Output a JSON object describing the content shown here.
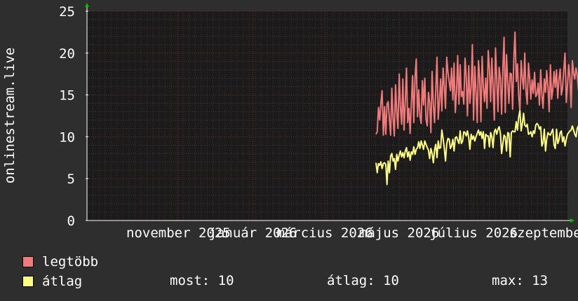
{
  "chart_data": {
    "type": "line",
    "ylabel": "onlinestream.live",
    "ylim": [
      0,
      25
    ],
    "yticks": [
      0,
      5,
      10,
      15,
      20,
      25
    ],
    "x_range": [
      "2025-09-01",
      "2026-09-30"
    ],
    "x_tick_labels": [
      {
        "label": "november 2025",
        "date": "2025-11-15"
      },
      {
        "label": "január 2026",
        "date": "2026-01-15"
      },
      {
        "label": "március 2026",
        "date": "2026-03-15"
      },
      {
        "label": "május 2026",
        "date": "2026-05-15"
      },
      {
        "label": "július 2026",
        "date": "2026-07-15"
      },
      {
        "label": "szeptember",
        "date": "2026-09-15"
      }
    ],
    "grid": true,
    "legend_position": "bottom-left",
    "series": [
      {
        "name": "legtöbb",
        "color": "#f07a7a",
        "start": "2026-04-26",
        "step_days": 1,
        "values": [
          10.3,
          10.6,
          13.5,
          12.0,
          14.0,
          15.5,
          10.2,
          13.6,
          10.3,
          13.9,
          14.2,
          12.0,
          10.2,
          15.8,
          12.2,
          10.1,
          16.2,
          12.9,
          11.0,
          17.5,
          13.5,
          11.5,
          16.9,
          10.8,
          14.2,
          18.2,
          11.7,
          13.4,
          10.4,
          14.2,
          17.3,
          11.7,
          17.1,
          19.3,
          12.4,
          15.6,
          12.5,
          11.6,
          16.7,
          13.8,
          17.0,
          12.1,
          11.3,
          15.3,
          14.1,
          10.5,
          17.8,
          13.8,
          11.7,
          15.5,
          19.5,
          12.1,
          14.2,
          16.9,
          13.1,
          18.2,
          16.0,
          13.4,
          19.5,
          17.7,
          16.6,
          15.5,
          18.2,
          14.4,
          18.8,
          12.9,
          15.3,
          19.7,
          13.9,
          18.6,
          14.8,
          15.4,
          13.9,
          19.4,
          17.1,
          12.5,
          18.5,
          14.0,
          16.0,
          21.0,
          12.0,
          18.4,
          15.3,
          11.7,
          19.1,
          17.1,
          11.8,
          19.6,
          16.0,
          14.2,
          17.0,
          13.4,
          20.3,
          18.2,
          14.2,
          19.4,
          16.0,
          12.0,
          20.6,
          16.8,
          13.0,
          18.3,
          16.9,
          12.7,
          18.2,
          21.9,
          12.9,
          19.8,
          16.6,
          14.0,
          17.6,
          17.5,
          13.3,
          19.3,
          22.5,
          16.6,
          18.7,
          14.8,
          13.0,
          19.1,
          17.0,
          15.7,
          20.0,
          15.4,
          13.9,
          18.8,
          17.0,
          14.5,
          16.8,
          15.2,
          17.7,
          14.8,
          15.1,
          16.4,
          13.8,
          18.0,
          15.0,
          13.4,
          16.9,
          15.3,
          17.9,
          15.9,
          13.0,
          18.6,
          14.5,
          15.6,
          17.8,
          15.9,
          18.0,
          14.6,
          16.8,
          18.1,
          15.0,
          15.8,
          18.1,
          20.0,
          14.1,
          16.1,
          18.6,
          17.0,
          13.5,
          19.1,
          17.6,
          16.9,
          18.2,
          17.4,
          15.6,
          19.8,
          14.1,
          13.1,
          19.8,
          17.2,
          15.3,
          17.8,
          15.9,
          12.4,
          18.6,
          16.1,
          19.0,
          20.4,
          17.1,
          17.3
        ]
      },
      {
        "name": "átlag",
        "color": "#ffff80",
        "start": "2026-04-26",
        "step_days": 1,
        "values": [
          6.9,
          5.7,
          6.8,
          6.6,
          7.0,
          6.2,
          6.8,
          6.9,
          6.7,
          4.3,
          7.1,
          5.7,
          7.7,
          8.0,
          7.1,
          7.4,
          6.1,
          7.9,
          7.1,
          7.8,
          8.3,
          7.6,
          8.1,
          7.5,
          8.3,
          8.7,
          7.6,
          8.2,
          7.2,
          8.2,
          7.9,
          8.8,
          7.9,
          8.5,
          8.7,
          9.4,
          8.6,
          9.5,
          9.0,
          8.5,
          9.5,
          9.1,
          8.7,
          8.4,
          7.4,
          8.6,
          8.0,
          6.9,
          8.4,
          9.1,
          7.5,
          9.5,
          8.6,
          8.7,
          10.8,
          9.8,
          8.6,
          7.1,
          9.2,
          9.8,
          9.7,
          8.6,
          8.9,
          9.7,
          8.3,
          9.9,
          10.0,
          9.6,
          9.2,
          10.7,
          9.2,
          9.5,
          10.6,
          10.5,
          10.1,
          10.7,
          9.9,
          8.5,
          10.3,
          9.7,
          10.1,
          9.5,
          10.0,
          10.4,
          10.8,
          10.2,
          10.6,
          9.8,
          10.6,
          8.6,
          10.3,
          10.1,
          10.1,
          8.8,
          10.5,
          10.0,
          8.7,
          10.6,
          10.9,
          10.3,
          10.9,
          11.2,
          10.4,
          8.0,
          9.2,
          10.2,
          10.0,
          8.3,
          10.5,
          10.4,
          7.6,
          10.5,
          10.7,
          10.6,
          10.6,
          11.8,
          10.8,
          12.4,
          13.1,
          10.7,
          11.6,
          12.8,
          11.4,
          11.2,
          11.5,
          10.3,
          10.4,
          10.6,
          10.0,
          10.7,
          10.4,
          11.4,
          11.6,
          11.4,
          10.9,
          11.2,
          8.9,
          9.3,
          10.9,
          8.3,
          9.7,
          10.5,
          10.3,
          10.2,
          10.6,
          10.9,
          9.0,
          8.6,
          10.9,
          9.2,
          9.6,
          10.5,
          10.7,
          9.4,
          10.0,
          8.9,
          9.7,
          10.3,
          10.5,
          10.7,
          10.8,
          11.3,
          10.8,
          10.3,
          10.0,
          11.0,
          11.3,
          9.8,
          11.0,
          11.3,
          11.6,
          10.8,
          11.7,
          10.7,
          11.2,
          10.7,
          10.4,
          10.6,
          10.7,
          11.4,
          10.1,
          11.4,
          10.5,
          11.6,
          12.0,
          11.0,
          11.5,
          11.6,
          10.8,
          10.5,
          10.3,
          10.6,
          10.3,
          11.0,
          10.5,
          10.1,
          9.2,
          10.6,
          10.9,
          10.1,
          9.8,
          10.0
        ]
      }
    ],
    "stats": {
      "now_label": "most:",
      "now_value": "10",
      "avg_label": "átlag:",
      "avg_value": "10",
      "max_label": "max:",
      "max_value": "13"
    }
  }
}
